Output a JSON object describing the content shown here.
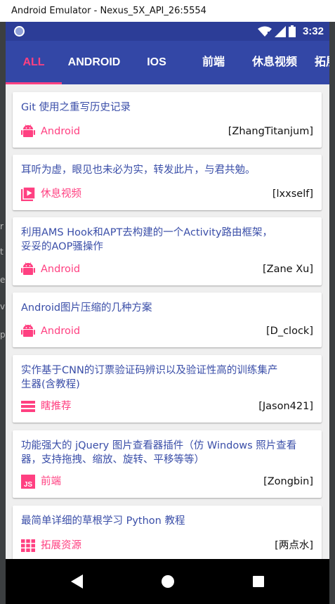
{
  "window": {
    "title": "Android Emulator - Nexus_5X_API_26:5554"
  },
  "status_bar": {
    "time": "3:32"
  },
  "tabs": [
    {
      "label": "ALL",
      "active": true
    },
    {
      "label": "ANDROID",
      "active": false
    },
    {
      "label": "IOS",
      "active": false
    },
    {
      "label": "前端",
      "active": false
    },
    {
      "label": "休息视频",
      "active": false
    },
    {
      "label": "拓展",
      "active": false
    }
  ],
  "feed": [
    {
      "title": "Git 使用之重写历史记录",
      "category": "Android",
      "icon": "android-icon",
      "author": "[ZhangTitanjum]"
    },
    {
      "title": "耳听为虚，眼见也未必为实，转发此片，与君共勉。",
      "category": "休息视频",
      "icon": "video-icon",
      "author": "[lxxself]"
    },
    {
      "title": "利用AMS Hook和APT去构建的一个Activity路由框架，妥妥的AOP骚操作",
      "category": "Android",
      "icon": "android-icon",
      "author": "[Zane Xu]"
    },
    {
      "title": "Android图片压缩的几种方案",
      "category": "Android",
      "icon": "android-icon",
      "author": "[D_clock]"
    },
    {
      "title": "实作基于CNN的订票验证码辨识以及验证性高的训练集产生器(含教程)",
      "category": "瞎推荐",
      "icon": "list-icon",
      "author": "[Jason421]"
    },
    {
      "title": "功能强大的 jQuery 图片查看器插件（仿 Windows 照片查看器，支持拖拽、缩放、旋转、平移等等）",
      "category": "前端",
      "icon": "js-icon",
      "author": "[Zongbin]"
    },
    {
      "title": "最简单详细的草根学习 Python 教程",
      "category": "拓展资源",
      "icon": "grid-icon",
      "author": "[两点水]"
    }
  ],
  "colors": {
    "primary": "#3347a6",
    "primary_dark": "#2c3d97",
    "accent": "#ff4081",
    "title_text": "#3a4ea8"
  }
}
